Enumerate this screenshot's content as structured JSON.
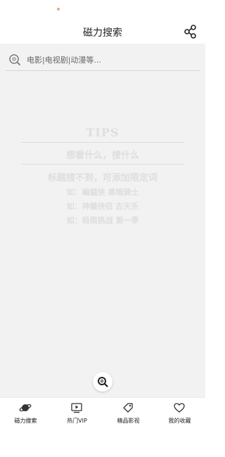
{
  "header": {
    "title": "磁力搜索"
  },
  "search": {
    "placeholder": "电影|电视剧|动漫等..."
  },
  "tips": {
    "title": "TIPS",
    "line1": "想看什么，搜什么",
    "line2": "标题搜不到，可添加限定词",
    "examples": [
      "如：蝙蝠侠 黑暗骑士",
      "如：神雕侠侣 古天乐",
      "如：极限挑战 第一季"
    ]
  },
  "tabs": [
    {
      "label": "磁力搜索",
      "icon": "planet-icon",
      "active": true
    },
    {
      "label": "热门VIP",
      "icon": "tv-play-icon",
      "active": false
    },
    {
      "label": "精品影视",
      "icon": "tag-icon",
      "active": false
    },
    {
      "label": "我的收藏",
      "icon": "heart-icon",
      "active": false
    }
  ],
  "colors": {
    "background": "#f2f2f2",
    "tips_text": "#dedede",
    "accent_dot": "#e6a58a"
  }
}
